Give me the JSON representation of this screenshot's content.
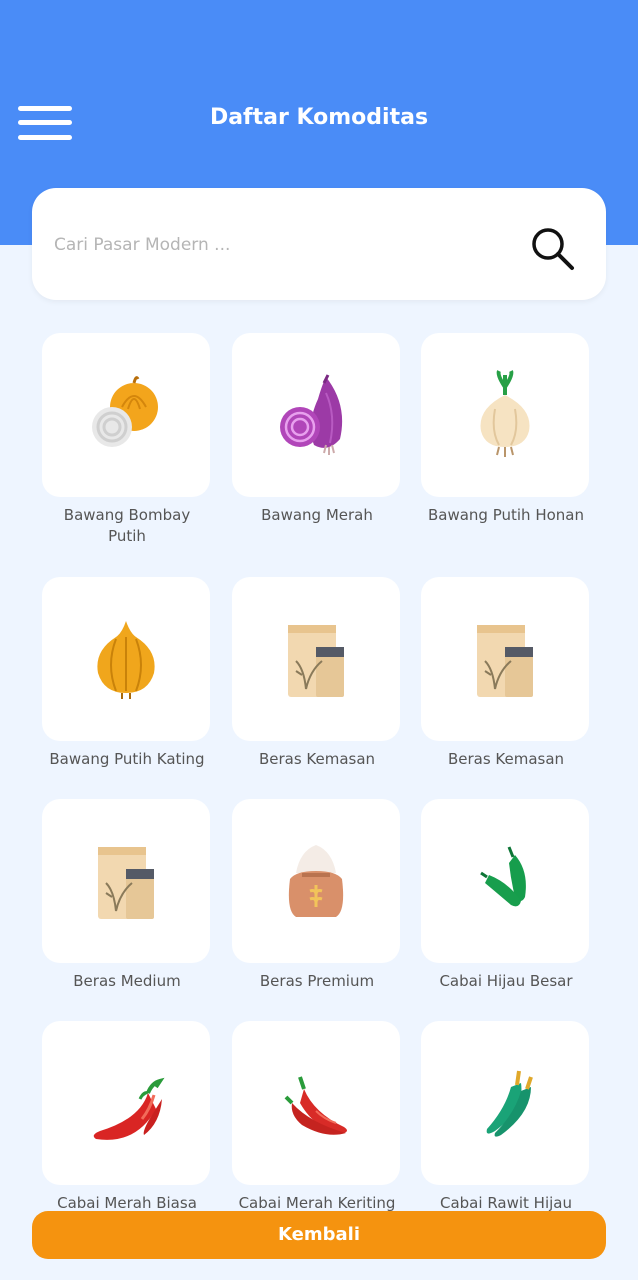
{
  "header": {
    "title": "Daftar Komoditas",
    "menu_icon": "hamburger-menu-icon"
  },
  "search": {
    "placeholder": "Cari Pasar Modern ...",
    "value": "",
    "icon": "search-icon"
  },
  "items": [
    {
      "label": "Bawang Bombay Putih",
      "icon": "onion-icon"
    },
    {
      "label": "Bawang Merah",
      "icon": "red-onion-icon"
    },
    {
      "label": "Bawang Putih Honan",
      "icon": "garlic-icon"
    },
    {
      "label": "Bawang Putih Kating",
      "icon": "onion-icon"
    },
    {
      "label": "Beras Kemasan",
      "icon": "rice-package-icon"
    },
    {
      "label": "Beras Kemasan",
      "icon": "rice-package-icon"
    },
    {
      "label": "Beras Medium",
      "icon": "rice-package-icon"
    },
    {
      "label": "Beras Premium",
      "icon": "rice-sack-icon"
    },
    {
      "label": "Cabai Hijau Besar",
      "icon": "green-chili-icon"
    },
    {
      "label": "Cabai Merah Biasa",
      "icon": "red-chili-icon"
    },
    {
      "label": "Cabai Merah Keriting",
      "icon": "red-chili-icon"
    },
    {
      "label": "Cabai Rawit Hijau",
      "icon": "green-chili-icon"
    }
  ],
  "footer": {
    "back_label": "Kembali"
  },
  "colors": {
    "header": "#4a8cf7",
    "background": "#eef5ff",
    "button": "#f5930f"
  }
}
